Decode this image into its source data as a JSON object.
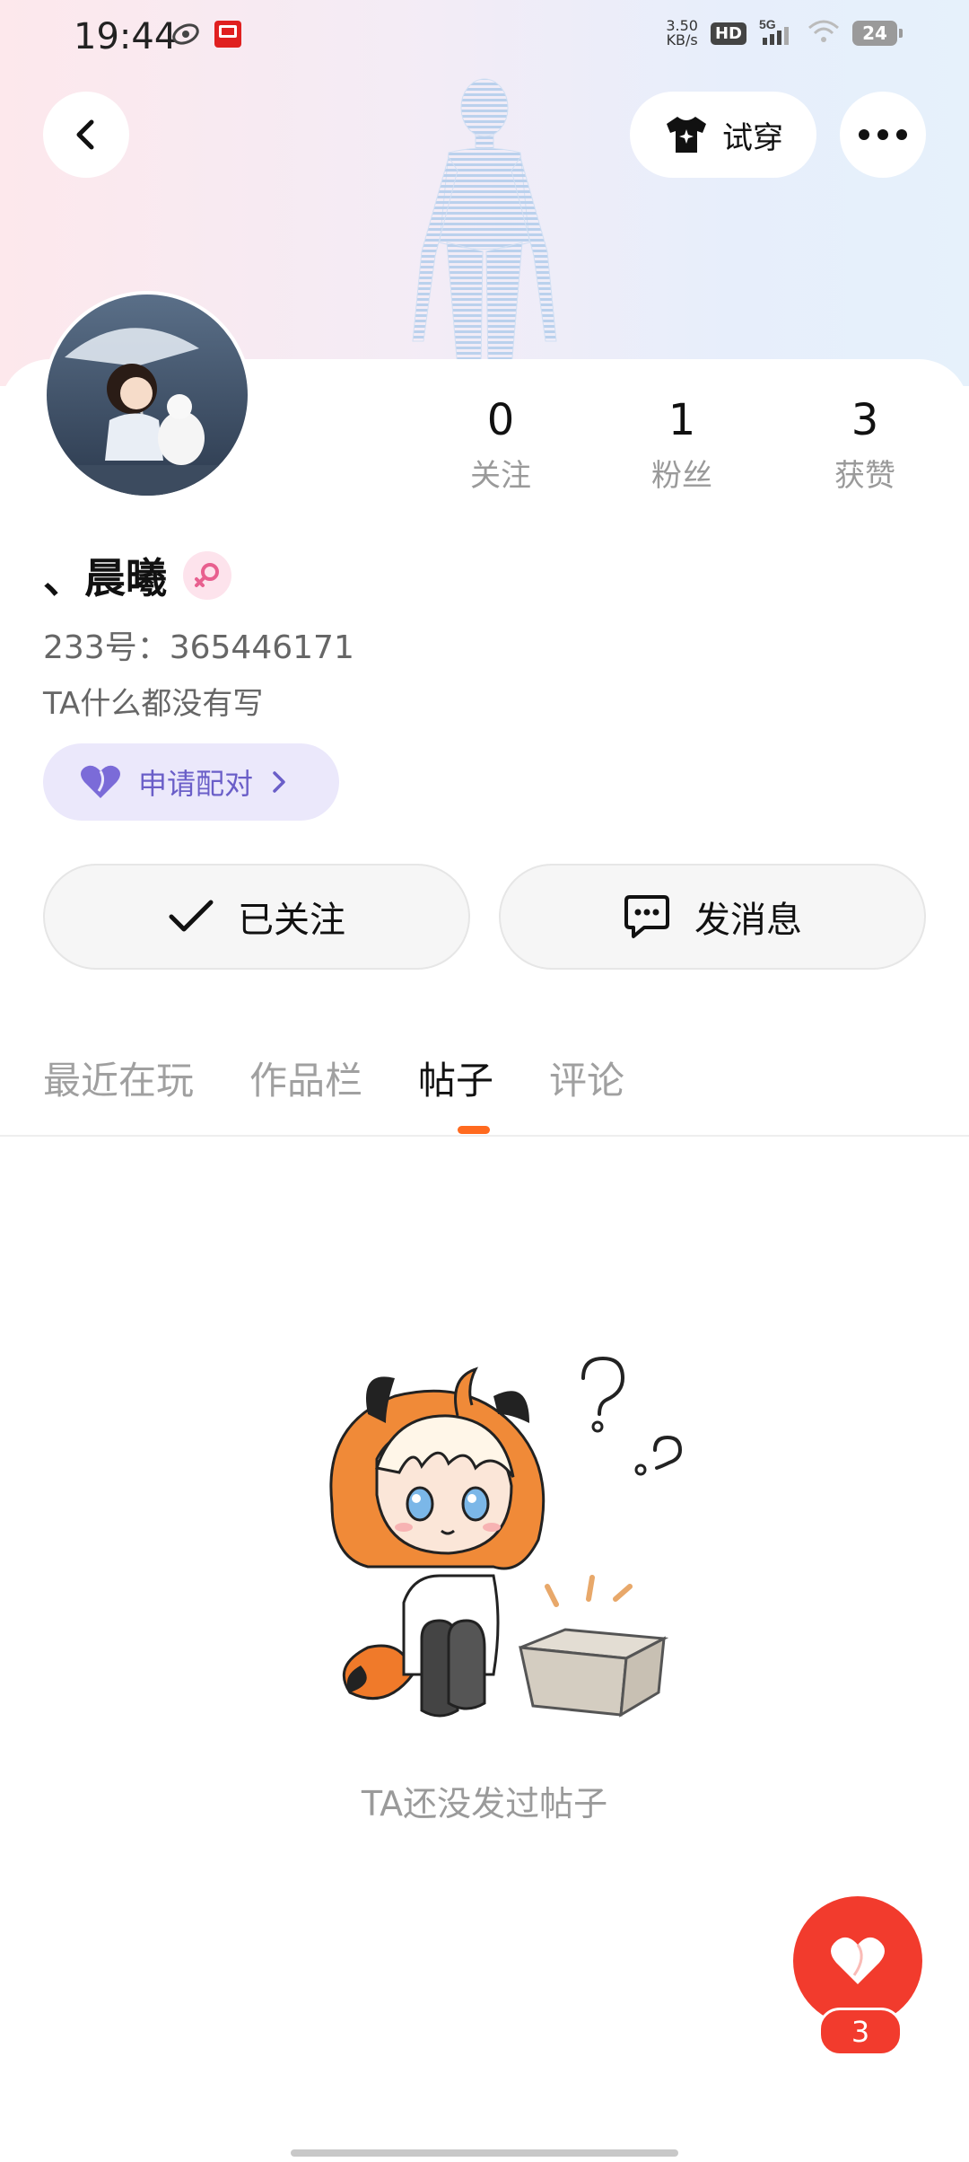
{
  "status_bar": {
    "time": "19:44",
    "net_speed": "3.50\nKB/s",
    "hd": "HD",
    "signal": "5G",
    "battery": "24"
  },
  "header": {
    "try_on_label": "试穿"
  },
  "profile": {
    "stats": [
      {
        "num": "0",
        "label": "关注"
      },
      {
        "num": "1",
        "label": "粉丝"
      },
      {
        "num": "3",
        "label": "获赞"
      }
    ],
    "name": "、晨曦",
    "uid": "233号：365446171",
    "bio": "TA什么都没有写",
    "pair_label": "申请配对"
  },
  "actions": {
    "followed_label": "已关注",
    "message_label": "发消息"
  },
  "tabs": [
    {
      "label": "最近在玩"
    },
    {
      "label": "作品栏"
    },
    {
      "label": "帖子"
    },
    {
      "label": "评论"
    }
  ],
  "empty": {
    "text": "TA还没发过帖子"
  },
  "like": {
    "count": "3"
  },
  "colors": {
    "accent_orange": "#ff6a1f",
    "like_red": "#f23b2d",
    "pair_purple": "#6a5ec8"
  }
}
